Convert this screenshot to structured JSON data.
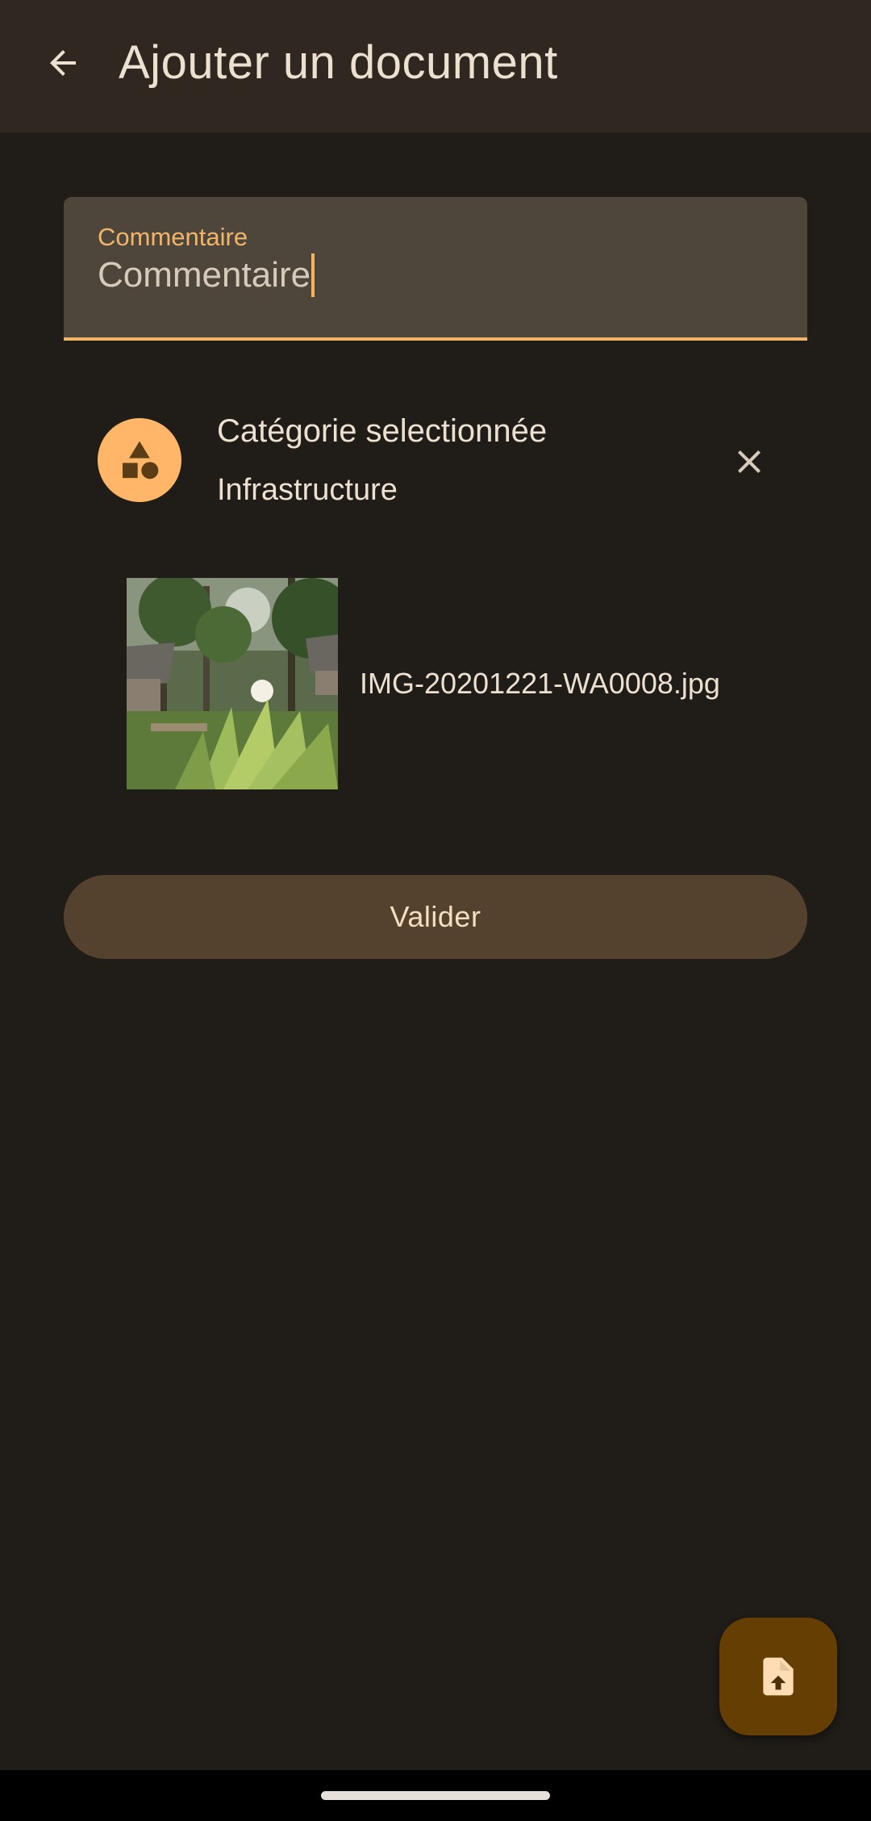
{
  "app_bar": {
    "title": "Ajouter un document",
    "back_icon": "arrow-back-icon"
  },
  "comment_field": {
    "label": "Commentaire",
    "value": "Commentaire"
  },
  "category": {
    "title": "Catégorie selectionnée",
    "value": "Infrastructure",
    "icon": "category-shapes-icon",
    "clear_icon": "close-icon"
  },
  "attachment": {
    "file_name": "IMG-20201221-WA0008.jpg"
  },
  "actions": {
    "validate_label": "Valider"
  },
  "fab": {
    "icon": "file-upload-icon"
  },
  "colors": {
    "background": "#201c18",
    "app_bar": "#302820",
    "accent": "#f1b56a",
    "field_bg": "#4f463b",
    "button_bg": "#55422e",
    "fab_bg": "#653e04",
    "avatar_bg": "#ffb668"
  }
}
